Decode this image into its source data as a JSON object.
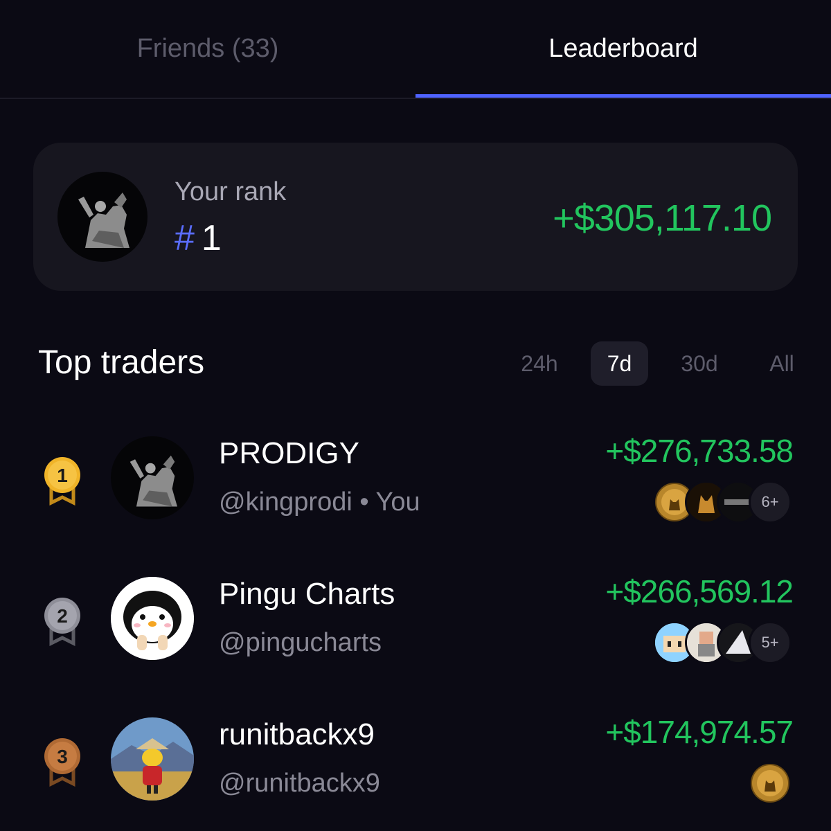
{
  "tabs": [
    {
      "label": "Friends (33)",
      "active": false
    },
    {
      "label": "Leaderboard",
      "active": true
    }
  ],
  "accent_color": "#4f63ff",
  "positive_color": "#22c55e",
  "your_rank": {
    "label": "Your rank",
    "hash": "#",
    "rank": "1",
    "pnl": "+$305,117.10"
  },
  "top_traders": {
    "title": "Top traders",
    "periods": [
      {
        "label": "24h",
        "active": false
      },
      {
        "label": "7d",
        "active": true
      },
      {
        "label": "30d",
        "active": false
      },
      {
        "label": "All",
        "active": false
      }
    ],
    "rows": [
      {
        "rank": "1",
        "medal": "gold",
        "name": "PRODIGY",
        "handle": "@kingprodi • You",
        "pnl": "+$276,733.58",
        "more": "6+",
        "tokens": [
          "gold-cat-coin-icon",
          "gold-dog-coin-icon",
          "dark-text-coin-icon"
        ]
      },
      {
        "rank": "2",
        "medal": "silver",
        "name": "Pingu Charts",
        "handle": "@pingucharts",
        "pnl": "+$266,569.12",
        "more": "5+",
        "tokens": [
          "pixel-face-coin-icon",
          "pixel-character-coin-icon",
          "white-shape-coin-icon"
        ]
      },
      {
        "rank": "3",
        "medal": "bronze",
        "name": "runitbackx9",
        "handle": "@runitbackx9",
        "pnl": "+$174,974.57",
        "more": "",
        "tokens": [
          "gold-cat-coin-icon"
        ]
      }
    ]
  }
}
